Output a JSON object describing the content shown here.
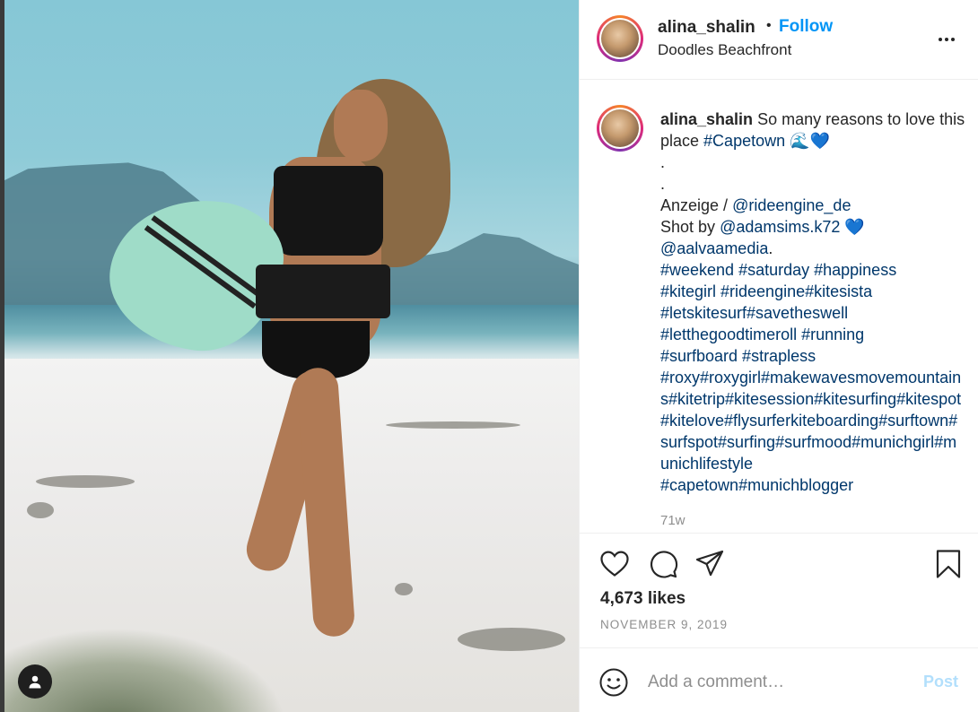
{
  "post": {
    "username": "alina_shalin",
    "separator": "•",
    "follow_label": "Follow",
    "location": "Doodles Beachfront",
    "more_icon": "more-horizontal-icon"
  },
  "caption": {
    "username": "alina_shalin",
    "text_intro": "So many reasons to love this place",
    "hashtag_capetown": "#Capetown",
    "emoji": "🌊💙",
    "dot1": ".",
    "dot2": ".",
    "ad_prefix": "Anzeige /",
    "ad_mention": "@rideengine_de",
    "shot_prefix": "Shot by",
    "shot_mention": "@adamsims.k72",
    "shot_emoji": "💙",
    "media_mention": "@aalvaamedia",
    "media_suffix": ".",
    "tags_line1": "#weekend #saturday #happiness",
    "tags_line2": "#kitegirl #rideengine#kitesista",
    "tags_line3": "#letskitesurf#savetheswell",
    "tags_line4": "#letthegoodtimeroll #running",
    "tags_line5": "#surfboard #strapless",
    "tags_block": "#roxy#roxygirl#makewavesmovemountains#kitetrip#kitesession#kitesurfing#kitespot#kitelove#flysurferkiteboarding#surftown#surfspot#surfing#surfmood#munichgirl#munichlifestyle",
    "tags_last": "#capetown#munichblogger",
    "time_ago": "71w"
  },
  "actions": {
    "like_icon": "heart-icon",
    "comment_icon": "comment-icon",
    "share_icon": "send-icon",
    "save_icon": "bookmark-icon"
  },
  "stats": {
    "likes": "4,673 likes",
    "date": "NOVEMBER 9, 2019"
  },
  "comment_box": {
    "placeholder": "Add a comment…",
    "post_label": "Post",
    "post_color_disabled": "#b2dffc"
  },
  "colors": {
    "link": "#00376b",
    "follow": "#0095f6",
    "muted": "#8e8e8e"
  }
}
